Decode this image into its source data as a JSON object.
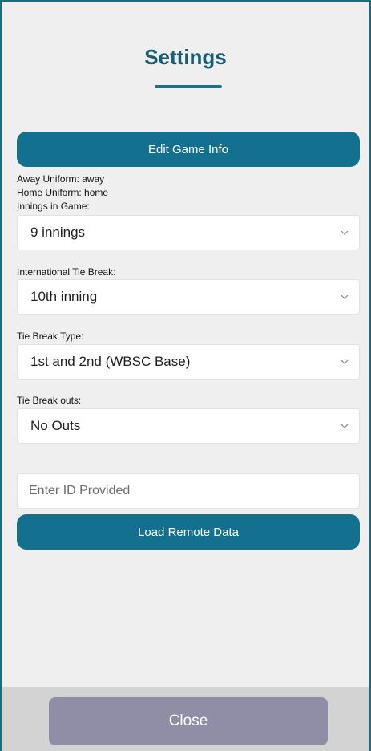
{
  "header": {
    "title": "Settings"
  },
  "edit_game_info": {
    "label": "Edit Game Info"
  },
  "uniforms": {
    "away": "Away Uniform: away",
    "home": "Home Uniform: home"
  },
  "innings": {
    "label": "Innings in Game:",
    "value": "9 innings"
  },
  "international_tie_break": {
    "label": "International Tie Break:",
    "value": "10th inning"
  },
  "tie_break_type": {
    "label": "Tie Break Type:",
    "value": "1st and 2nd (WBSC Base)"
  },
  "tie_break_outs": {
    "label": "Tie Break outs:",
    "value": "No Outs"
  },
  "remote": {
    "placeholder": "Enter ID Provided",
    "load_label": "Load Remote Data"
  },
  "footer": {
    "close_label": "Close"
  },
  "colors": {
    "accent": "#13708e",
    "title": "#1a5c73",
    "close_button": "#8f8ea6",
    "background": "#efefef"
  },
  "icons": {
    "select_arrow": "chevron-down-icon"
  }
}
